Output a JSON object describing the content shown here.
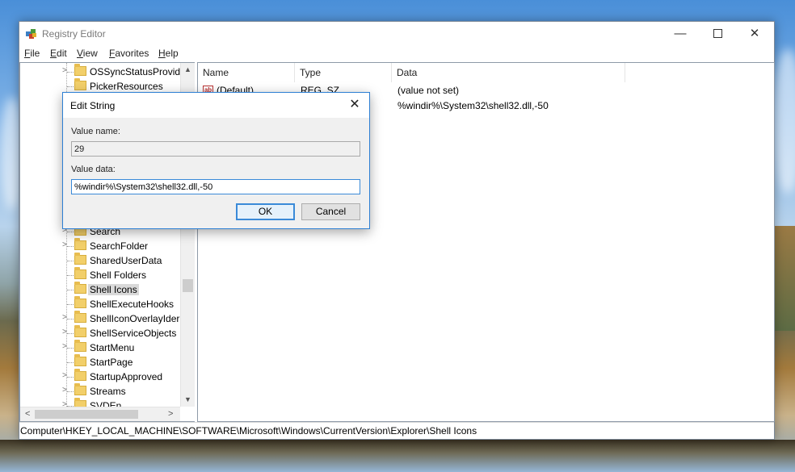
{
  "window": {
    "title": "Registry Editor",
    "controls": {
      "minimize": "—",
      "close": "✕"
    }
  },
  "menu": [
    "File",
    "Edit",
    "View",
    "Favorites",
    "Help"
  ],
  "tree": {
    "items": [
      {
        "label": "OSSyncStatusProvide",
        "expandable": true
      },
      {
        "label": "PickerResources",
        "expandable": false
      },
      {
        "label": "Search",
        "expandable": true
      },
      {
        "label": "SearchFolder",
        "expandable": true
      },
      {
        "label": "SharedUserData",
        "expandable": false
      },
      {
        "label": "Shell Folders",
        "expandable": false
      },
      {
        "label": "Shell Icons",
        "expandable": false,
        "selected": true
      },
      {
        "label": "ShellExecuteHooks",
        "expandable": false
      },
      {
        "label": "ShellIconOverlayIder",
        "expandable": true
      },
      {
        "label": "ShellServiceObjects",
        "expandable": true
      },
      {
        "label": "StartMenu",
        "expandable": true
      },
      {
        "label": "StartPage",
        "expandable": false
      },
      {
        "label": "StartupApproved",
        "expandable": true
      },
      {
        "label": "Streams",
        "expandable": true
      },
      {
        "label": "SVDEn",
        "expandable": true
      }
    ],
    "scroll": {
      "up": "▲",
      "down": "▼",
      "left": "<",
      "right": ">"
    }
  },
  "list": {
    "columns": [
      "Name",
      "Type",
      "Data"
    ],
    "rows": [
      {
        "name": "(Default)",
        "type": "REG_SZ",
        "data": "(value not set)"
      },
      {
        "name": "",
        "type": "",
        "data": "%windir%\\System32\\shell32.dll,-50"
      }
    ]
  },
  "status_path": "Computer\\HKEY_LOCAL_MACHINE\\SOFTWARE\\Microsoft\\Windows\\CurrentVersion\\Explorer\\Shell Icons",
  "dialog": {
    "title": "Edit String",
    "close": "✕",
    "value_name_label": "Value name:",
    "value_name": "29",
    "value_data_label": "Value data:",
    "value_data": "%windir%\\System32\\shell32.dll,-50",
    "ok": "OK",
    "cancel": "Cancel"
  },
  "colors": {
    "accent": "#2d7fd3",
    "selection": "#d9d9d9",
    "folder": "#f2cf6a"
  }
}
